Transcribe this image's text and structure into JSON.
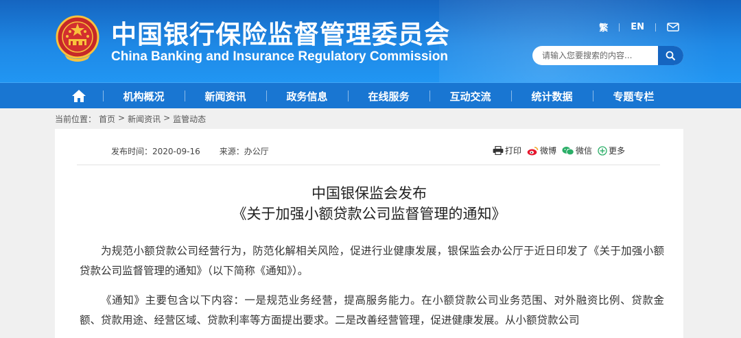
{
  "header": {
    "title_cn": "中国银行保险监督管理委员会",
    "title_en": "China Banking and Insurance Regulatory Commission",
    "emblem_icon": "national-emblem-icon",
    "lang_traditional": "繁",
    "lang_en": "EN",
    "mail_icon": "mail-icon",
    "search": {
      "placeholder": "请输入您要搜索的内容...",
      "icon": "search-icon"
    }
  },
  "nav": {
    "home_icon": "home-icon",
    "items": [
      "机构概况",
      "新闻资讯",
      "政务信息",
      "在线服务",
      "互动交流",
      "统计数据",
      "专题专栏"
    ]
  },
  "breadcrumb": {
    "label": "当前位置：",
    "items": [
      "首页",
      "新闻资讯",
      "监管动态"
    ],
    "separator": ">"
  },
  "article": {
    "publish_time_label": "发布时间：2020-09-16",
    "source_label": "来源：办公厅",
    "share": {
      "print": "打印",
      "weibo": "微博",
      "wechat": "微信",
      "more": "更多"
    },
    "title_line1": "中国银保监会发布",
    "title_line2": "《关于加强小额贷款公司监督管理的通知》",
    "paragraphs": [
      "为规范小额贷款公司经营行为，防范化解相关风险，促进行业健康发展，银保监会办公厅于近日印发了《关于加强小额贷款公司监督管理的通知》（以下简称《通知》）。",
      "《通知》主要包含以下内容：一是规范业务经营，提高服务能力。在小额贷款公司业务范围、对外融资比例、贷款金额、贷款用途、经营区域、贷款利率等方面提出要求。二是改善经营管理，促进健康发展。从小额贷款公司"
    ]
  },
  "colors": {
    "header_blue": "#1976d2",
    "nav_blue": "#1976d2",
    "page_bg": "#f0f0f0"
  }
}
